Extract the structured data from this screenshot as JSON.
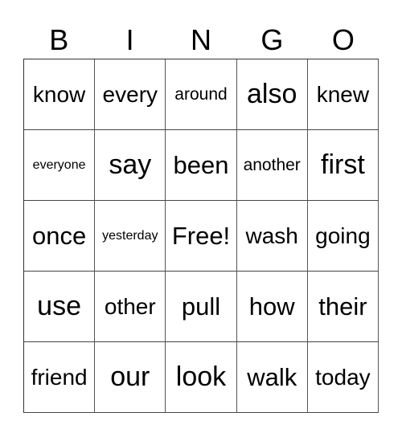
{
  "header": [
    "B",
    "I",
    "N",
    "G",
    "O"
  ],
  "cells": [
    [
      "know",
      "every",
      "around",
      "also",
      "knew"
    ],
    [
      "everyone",
      "say",
      "been",
      "another",
      "first"
    ],
    [
      "once",
      "yesterday",
      "Free!",
      "wash",
      "going"
    ],
    [
      "use",
      "other",
      "pull",
      "how",
      "their"
    ],
    [
      "friend",
      "our",
      "look",
      "walk",
      "today"
    ]
  ]
}
